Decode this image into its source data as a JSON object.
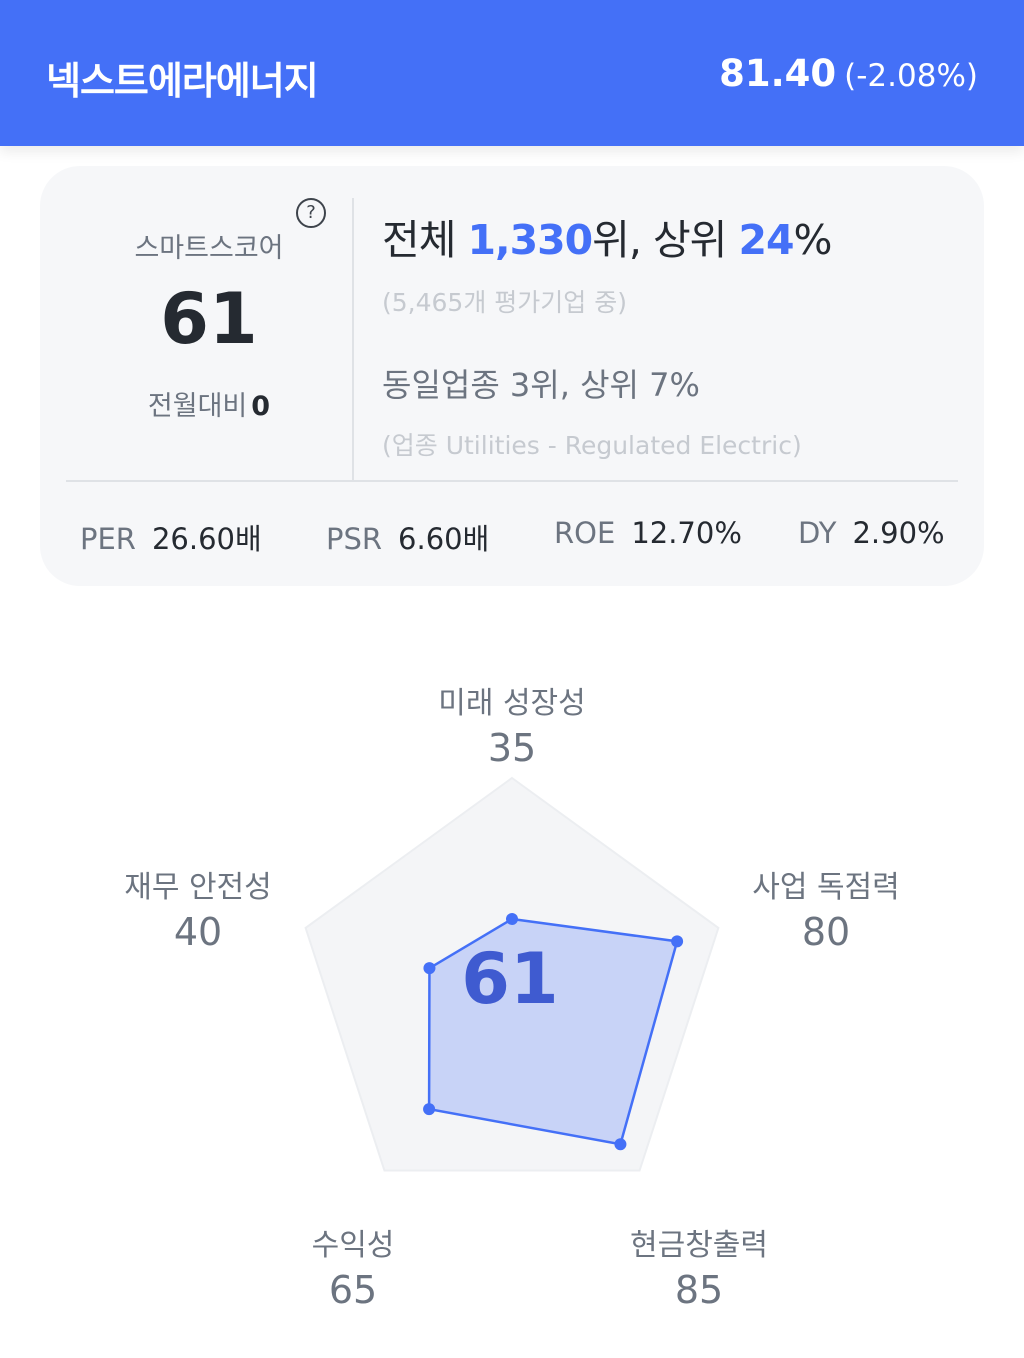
{
  "header": {
    "company_name": "넥스트에라에너지",
    "price": "81.40",
    "change": "(-2.08%)",
    "background_color": "#4470f7"
  },
  "score_card": {
    "label": "스마트스코어",
    "help_icon": "?",
    "score": "61",
    "mom_label": "전월대비",
    "mom_value": "0",
    "overall_prefix": "전체 ",
    "overall_rank": "1,330",
    "overall_mid": "위, 상위 ",
    "overall_percent": "24",
    "overall_suffix": "%",
    "evaluated_count": "(5,465개 평가기업 중)",
    "industry_rank": "동일업종 3위, 상위 7%",
    "industry_name": "(업종 Utilities - Regulated Electric)",
    "accent_color": "#4470f7"
  },
  "metrics": [
    {
      "label": "PER",
      "value": "26.60배"
    },
    {
      "label": "PSR",
      "value": "6.60배"
    },
    {
      "label": "ROE",
      "value": "12.70%"
    },
    {
      "label": "DY",
      "value": "2.90%"
    }
  ],
  "radar": {
    "center_score": "61",
    "max": 100,
    "fill_color": "#4470f7",
    "axes": [
      {
        "label": "미래 성장성",
        "value": "35"
      },
      {
        "label": "사업 독점력",
        "value": "80"
      },
      {
        "label": "현금창출력",
        "value": "85"
      },
      {
        "label": "수익성",
        "value": "65"
      },
      {
        "label": "재무 안전성",
        "value": "40"
      }
    ]
  }
}
